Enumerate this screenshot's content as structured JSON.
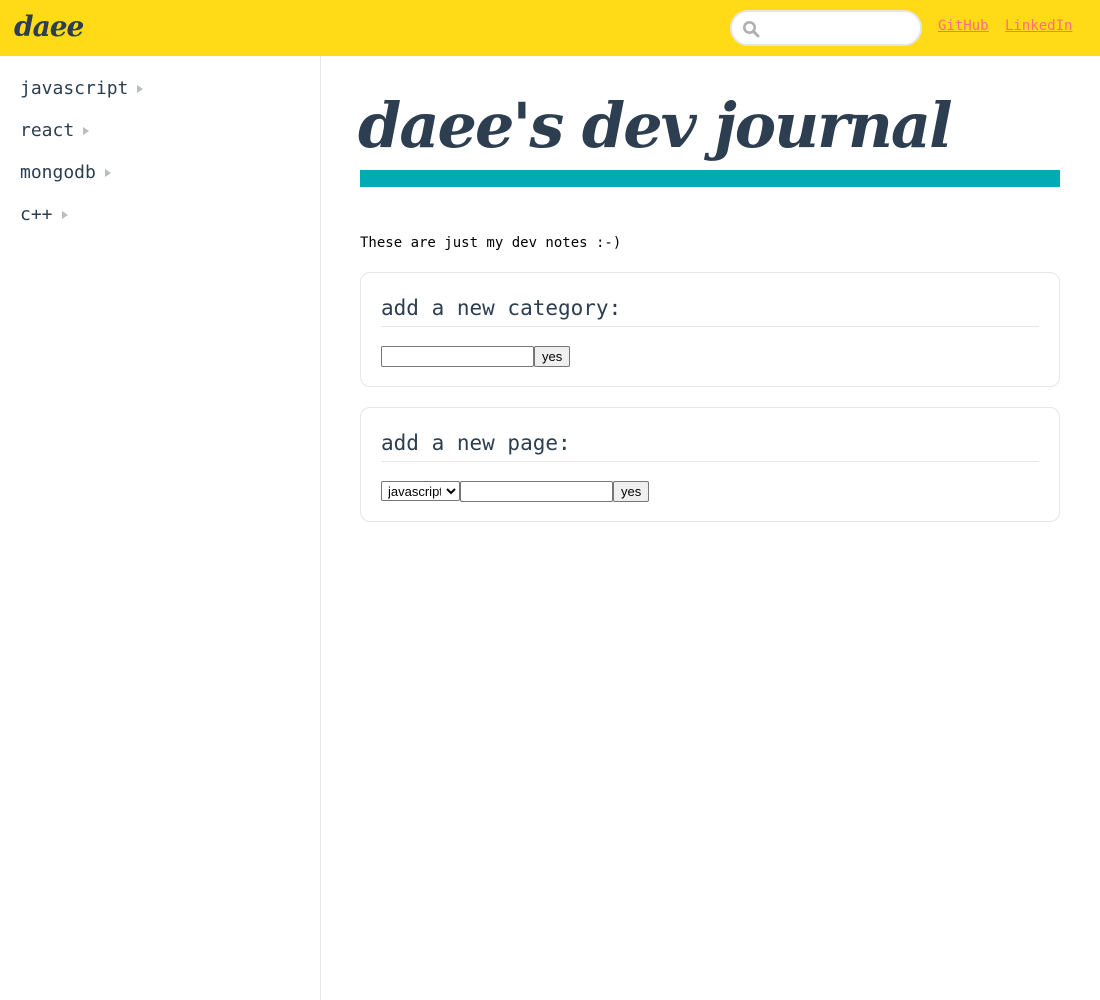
{
  "header": {
    "brand": "daee",
    "search": {
      "value": "",
      "placeholder": ""
    },
    "links": [
      {
        "label": "GitHub"
      },
      {
        "label": "LinkedIn"
      }
    ]
  },
  "sidebar": {
    "items": [
      {
        "label": "javascript"
      },
      {
        "label": "react"
      },
      {
        "label": "mongodb"
      },
      {
        "label": "c++"
      }
    ]
  },
  "main": {
    "title": "daee's dev journal",
    "intro": "These are just my dev notes :-)",
    "new_category": {
      "heading": "add a new category:",
      "input_value": "",
      "button_label": "yes"
    },
    "new_page": {
      "heading": "add a new page:",
      "select_value": "javascript",
      "input_value": "",
      "button_label": "yes"
    }
  },
  "colors": {
    "header_bg": "#ffda17",
    "accent_bar": "#00abb5",
    "text": "#2c3e50",
    "link": "#ff6f7d"
  },
  "icons": {
    "search": "search-icon",
    "caret": "caret-right-icon"
  }
}
